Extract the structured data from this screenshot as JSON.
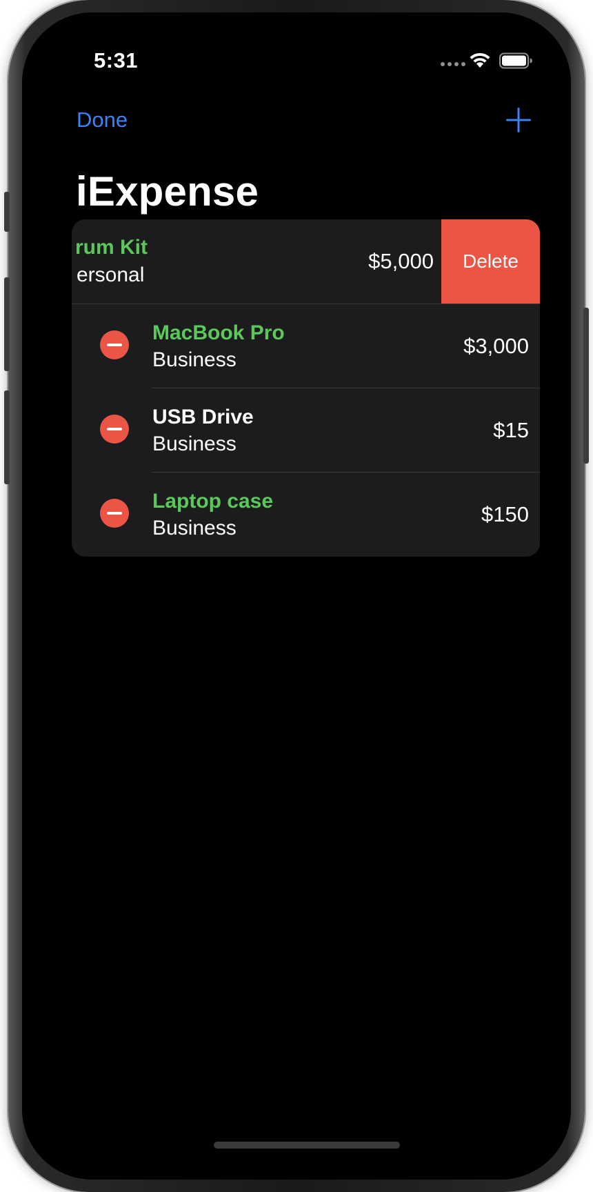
{
  "status_bar": {
    "time": "5:31"
  },
  "nav": {
    "done_label": "Done",
    "add_icon": "plus-icon",
    "title": "iExpense"
  },
  "expenses": [
    {
      "name": "rum Kit",
      "type": "ersonal",
      "amount": "$5,000",
      "name_color": "#5ac95a",
      "swiped": true,
      "delete_label": "Delete"
    },
    {
      "name": "MacBook Pro",
      "type": "Business",
      "amount": "$3,000",
      "name_color": "#5ac95a"
    },
    {
      "name": "USB Drive",
      "type": "Business",
      "amount": "$15",
      "name_color": "#ffffff"
    },
    {
      "name": "Laptop case",
      "type": "Business",
      "amount": "$150",
      "name_color": "#5ac95a"
    }
  ],
  "colors": {
    "accent": "#3a82f7",
    "destructive": "#eb5545",
    "green": "#5ac95a",
    "background": "#000000",
    "card": "#1c1c1e"
  }
}
